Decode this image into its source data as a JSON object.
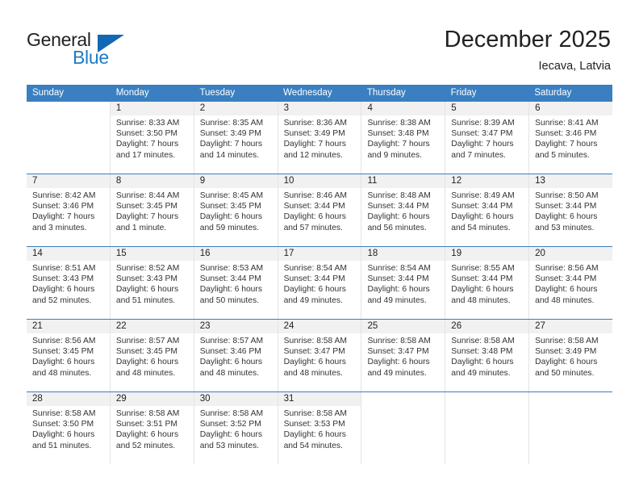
{
  "brand": {
    "name_top": "General",
    "name_bottom": "Blue",
    "accent_color": "#1d7cc4",
    "triangle_color": "#1268b3"
  },
  "header": {
    "month_title": "December 2025",
    "location": "Iecava, Latvia"
  },
  "calendar": {
    "header_bg": "#3a7fc1",
    "daynum_bg": "#f1f1f1",
    "weekdays": [
      "Sunday",
      "Monday",
      "Tuesday",
      "Wednesday",
      "Thursday",
      "Friday",
      "Saturday"
    ],
    "weeks": [
      [
        {
          "day": "",
          "sunrise": "",
          "sunset": "",
          "daylight_line1": "",
          "daylight_line2": ""
        },
        {
          "day": "1",
          "sunrise": "Sunrise: 8:33 AM",
          "sunset": "Sunset: 3:50 PM",
          "daylight_line1": "Daylight: 7 hours",
          "daylight_line2": "and 17 minutes."
        },
        {
          "day": "2",
          "sunrise": "Sunrise: 8:35 AM",
          "sunset": "Sunset: 3:49 PM",
          "daylight_line1": "Daylight: 7 hours",
          "daylight_line2": "and 14 minutes."
        },
        {
          "day": "3",
          "sunrise": "Sunrise: 8:36 AM",
          "sunset": "Sunset: 3:49 PM",
          "daylight_line1": "Daylight: 7 hours",
          "daylight_line2": "and 12 minutes."
        },
        {
          "day": "4",
          "sunrise": "Sunrise: 8:38 AM",
          "sunset": "Sunset: 3:48 PM",
          "daylight_line1": "Daylight: 7 hours",
          "daylight_line2": "and 9 minutes."
        },
        {
          "day": "5",
          "sunrise": "Sunrise: 8:39 AM",
          "sunset": "Sunset: 3:47 PM",
          "daylight_line1": "Daylight: 7 hours",
          "daylight_line2": "and 7 minutes."
        },
        {
          "day": "6",
          "sunrise": "Sunrise: 8:41 AM",
          "sunset": "Sunset: 3:46 PM",
          "daylight_line1": "Daylight: 7 hours",
          "daylight_line2": "and 5 minutes."
        }
      ],
      [
        {
          "day": "7",
          "sunrise": "Sunrise: 8:42 AM",
          "sunset": "Sunset: 3:46 PM",
          "daylight_line1": "Daylight: 7 hours",
          "daylight_line2": "and 3 minutes."
        },
        {
          "day": "8",
          "sunrise": "Sunrise: 8:44 AM",
          "sunset": "Sunset: 3:45 PM",
          "daylight_line1": "Daylight: 7 hours",
          "daylight_line2": "and 1 minute."
        },
        {
          "day": "9",
          "sunrise": "Sunrise: 8:45 AM",
          "sunset": "Sunset: 3:45 PM",
          "daylight_line1": "Daylight: 6 hours",
          "daylight_line2": "and 59 minutes."
        },
        {
          "day": "10",
          "sunrise": "Sunrise: 8:46 AM",
          "sunset": "Sunset: 3:44 PM",
          "daylight_line1": "Daylight: 6 hours",
          "daylight_line2": "and 57 minutes."
        },
        {
          "day": "11",
          "sunrise": "Sunrise: 8:48 AM",
          "sunset": "Sunset: 3:44 PM",
          "daylight_line1": "Daylight: 6 hours",
          "daylight_line2": "and 56 minutes."
        },
        {
          "day": "12",
          "sunrise": "Sunrise: 8:49 AM",
          "sunset": "Sunset: 3:44 PM",
          "daylight_line1": "Daylight: 6 hours",
          "daylight_line2": "and 54 minutes."
        },
        {
          "day": "13",
          "sunrise": "Sunrise: 8:50 AM",
          "sunset": "Sunset: 3:44 PM",
          "daylight_line1": "Daylight: 6 hours",
          "daylight_line2": "and 53 minutes."
        }
      ],
      [
        {
          "day": "14",
          "sunrise": "Sunrise: 8:51 AM",
          "sunset": "Sunset: 3:43 PM",
          "daylight_line1": "Daylight: 6 hours",
          "daylight_line2": "and 52 minutes."
        },
        {
          "day": "15",
          "sunrise": "Sunrise: 8:52 AM",
          "sunset": "Sunset: 3:43 PM",
          "daylight_line1": "Daylight: 6 hours",
          "daylight_line2": "and 51 minutes."
        },
        {
          "day": "16",
          "sunrise": "Sunrise: 8:53 AM",
          "sunset": "Sunset: 3:44 PM",
          "daylight_line1": "Daylight: 6 hours",
          "daylight_line2": "and 50 minutes."
        },
        {
          "day": "17",
          "sunrise": "Sunrise: 8:54 AM",
          "sunset": "Sunset: 3:44 PM",
          "daylight_line1": "Daylight: 6 hours",
          "daylight_line2": "and 49 minutes."
        },
        {
          "day": "18",
          "sunrise": "Sunrise: 8:54 AM",
          "sunset": "Sunset: 3:44 PM",
          "daylight_line1": "Daylight: 6 hours",
          "daylight_line2": "and 49 minutes."
        },
        {
          "day": "19",
          "sunrise": "Sunrise: 8:55 AM",
          "sunset": "Sunset: 3:44 PM",
          "daylight_line1": "Daylight: 6 hours",
          "daylight_line2": "and 48 minutes."
        },
        {
          "day": "20",
          "sunrise": "Sunrise: 8:56 AM",
          "sunset": "Sunset: 3:44 PM",
          "daylight_line1": "Daylight: 6 hours",
          "daylight_line2": "and 48 minutes."
        }
      ],
      [
        {
          "day": "21",
          "sunrise": "Sunrise: 8:56 AM",
          "sunset": "Sunset: 3:45 PM",
          "daylight_line1": "Daylight: 6 hours",
          "daylight_line2": "and 48 minutes."
        },
        {
          "day": "22",
          "sunrise": "Sunrise: 8:57 AM",
          "sunset": "Sunset: 3:45 PM",
          "daylight_line1": "Daylight: 6 hours",
          "daylight_line2": "and 48 minutes."
        },
        {
          "day": "23",
          "sunrise": "Sunrise: 8:57 AM",
          "sunset": "Sunset: 3:46 PM",
          "daylight_line1": "Daylight: 6 hours",
          "daylight_line2": "and 48 minutes."
        },
        {
          "day": "24",
          "sunrise": "Sunrise: 8:58 AM",
          "sunset": "Sunset: 3:47 PM",
          "daylight_line1": "Daylight: 6 hours",
          "daylight_line2": "and 48 minutes."
        },
        {
          "day": "25",
          "sunrise": "Sunrise: 8:58 AM",
          "sunset": "Sunset: 3:47 PM",
          "daylight_line1": "Daylight: 6 hours",
          "daylight_line2": "and 49 minutes."
        },
        {
          "day": "26",
          "sunrise": "Sunrise: 8:58 AM",
          "sunset": "Sunset: 3:48 PM",
          "daylight_line1": "Daylight: 6 hours",
          "daylight_line2": "and 49 minutes."
        },
        {
          "day": "27",
          "sunrise": "Sunrise: 8:58 AM",
          "sunset": "Sunset: 3:49 PM",
          "daylight_line1": "Daylight: 6 hours",
          "daylight_line2": "and 50 minutes."
        }
      ],
      [
        {
          "day": "28",
          "sunrise": "Sunrise: 8:58 AM",
          "sunset": "Sunset: 3:50 PM",
          "daylight_line1": "Daylight: 6 hours",
          "daylight_line2": "and 51 minutes."
        },
        {
          "day": "29",
          "sunrise": "Sunrise: 8:58 AM",
          "sunset": "Sunset: 3:51 PM",
          "daylight_line1": "Daylight: 6 hours",
          "daylight_line2": "and 52 minutes."
        },
        {
          "day": "30",
          "sunrise": "Sunrise: 8:58 AM",
          "sunset": "Sunset: 3:52 PM",
          "daylight_line1": "Daylight: 6 hours",
          "daylight_line2": "and 53 minutes."
        },
        {
          "day": "31",
          "sunrise": "Sunrise: 8:58 AM",
          "sunset": "Sunset: 3:53 PM",
          "daylight_line1": "Daylight: 6 hours",
          "daylight_line2": "and 54 minutes."
        },
        {
          "day": "",
          "sunrise": "",
          "sunset": "",
          "daylight_line1": "",
          "daylight_line2": ""
        },
        {
          "day": "",
          "sunrise": "",
          "sunset": "",
          "daylight_line1": "",
          "daylight_line2": ""
        },
        {
          "day": "",
          "sunrise": "",
          "sunset": "",
          "daylight_line1": "",
          "daylight_line2": ""
        }
      ]
    ]
  }
}
